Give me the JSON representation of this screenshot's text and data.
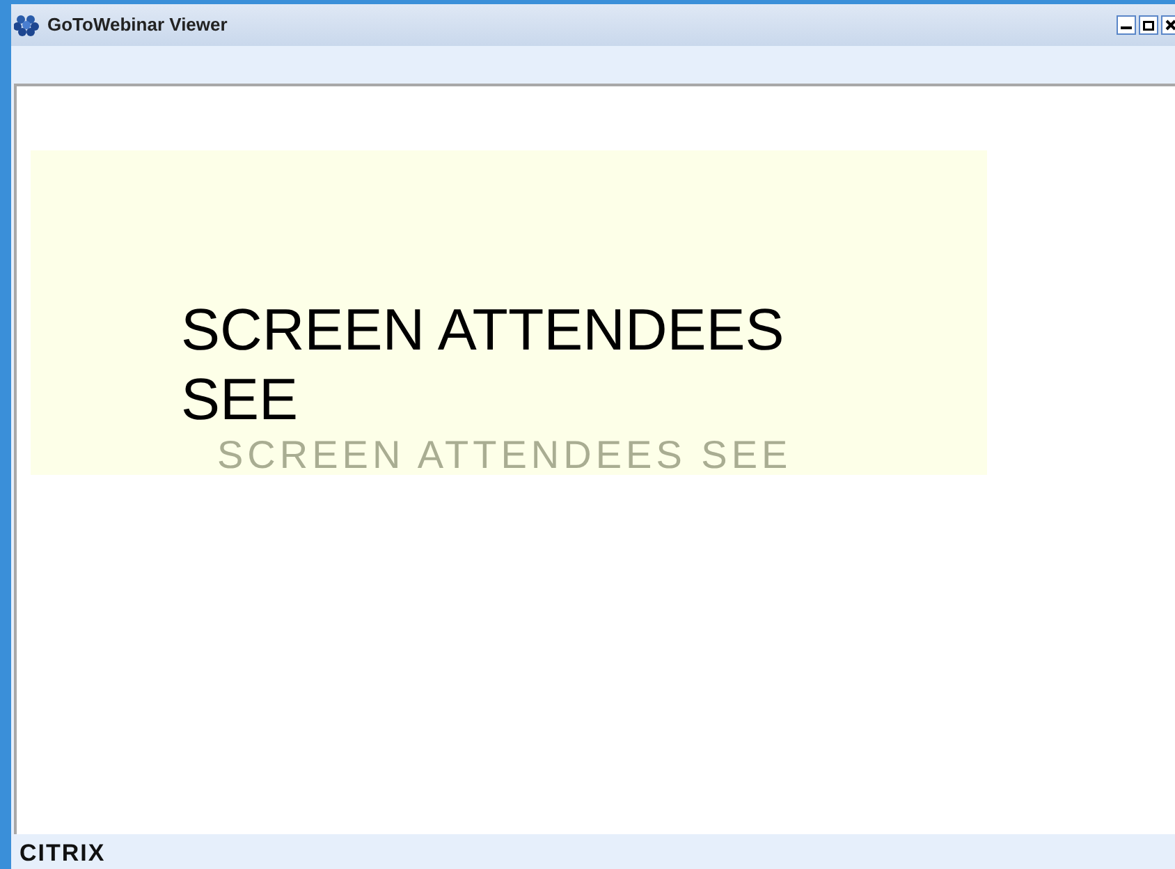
{
  "window": {
    "title": "GoToWebinar Viewer"
  },
  "slide": {
    "heading": "SCREEN ATTENDEES SEE",
    "faint_caption": "SCREEN ATTENDEES SEE"
  },
  "footer": {
    "logo": "CITRIX"
  }
}
